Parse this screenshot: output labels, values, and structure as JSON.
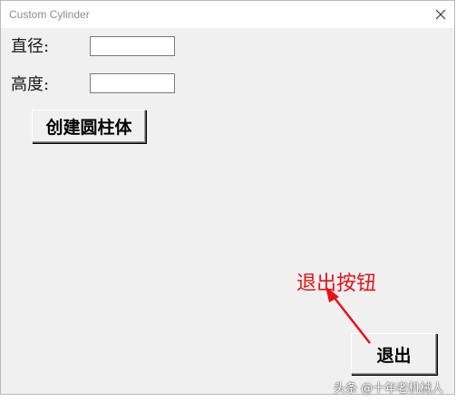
{
  "window": {
    "title": "Custom Cylinder"
  },
  "form": {
    "diameter_label": "直径:",
    "diameter_value": "",
    "height_label": "高度:",
    "height_value": "",
    "create_button_label": "创建圆柱体",
    "exit_button_label": "退出"
  },
  "annotation": {
    "text": "退出按钮",
    "color": "#e8121a"
  },
  "watermark": {
    "text": "头条 @十年老机械人"
  },
  "icons": {
    "close": "close-icon"
  }
}
